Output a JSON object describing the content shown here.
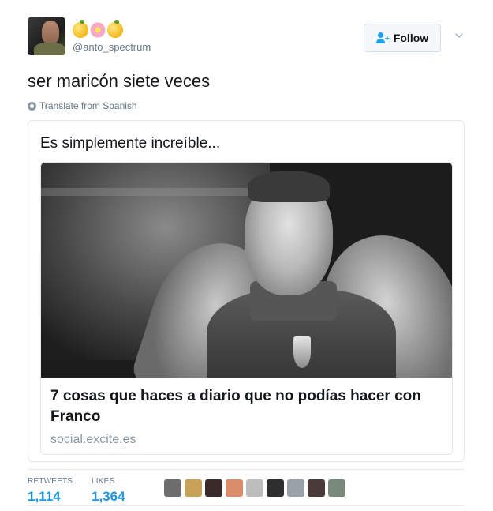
{
  "user": {
    "display_name_emojis": [
      "lemon",
      "flower",
      "lemon"
    ],
    "handle": "@anto_spectrum"
  },
  "follow_button": {
    "label": "Follow"
  },
  "tweet": {
    "text": "ser maricón siete veces",
    "translate_label": "Translate from Spanish"
  },
  "quoted_tweet": {
    "text": "Es simplemente increíble...",
    "link": {
      "title": "7 cosas que haces a diario que no podías hacer con Franco",
      "domain": "social.excite.es"
    }
  },
  "stats": {
    "retweets_label": "RETWEETS",
    "retweets_value": "1,114",
    "likes_label": "LIKES",
    "likes_value": "1,364"
  },
  "likers": [
    {
      "color": "#6d6d6d"
    },
    {
      "color": "#c9a25a"
    },
    {
      "color": "#3a2a2a"
    },
    {
      "color": "#d98b6a"
    },
    {
      "color": "#bdbdbd"
    },
    {
      "color": "#2e2e2e"
    },
    {
      "color": "#9aa0a8"
    },
    {
      "color": "#4a3a3a"
    },
    {
      "color": "#7a8a7a"
    }
  ]
}
